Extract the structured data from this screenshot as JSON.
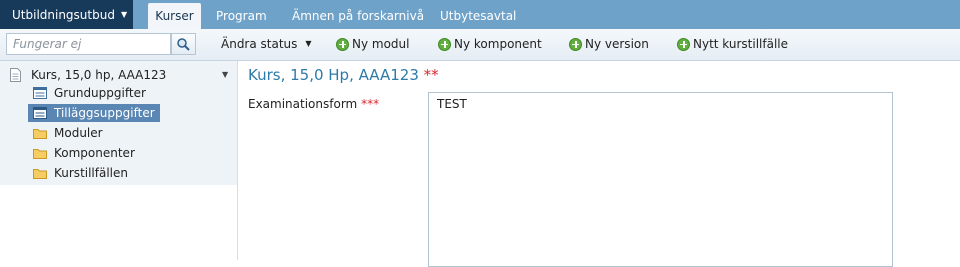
{
  "topbar": {
    "app_menu": "Utbildningsutbud",
    "tabs": [
      {
        "label": "Kurser",
        "active": true
      },
      {
        "label": "Program",
        "active": false
      },
      {
        "label": "Ämnen på forskarnivå",
        "active": false
      },
      {
        "label": "Utbytesavtal",
        "active": false
      }
    ]
  },
  "toolbar": {
    "search_placeholder": "Fungerar ej",
    "status_label": "Ändra status",
    "actions": [
      "Ny modul",
      "Ny komponent",
      "Ny version",
      "Nytt kurstillfälle"
    ]
  },
  "sidebar": {
    "root": "Kurs, 15,0 hp, AAA123",
    "items": [
      {
        "label": "Grunduppgifter",
        "icon": "form-icon",
        "selected": false
      },
      {
        "label": "Tilläggsuppgifter",
        "icon": "form-icon",
        "selected": true
      },
      {
        "label": "Moduler",
        "icon": "folder-icon",
        "selected": false
      },
      {
        "label": "Komponenter",
        "icon": "folder-icon",
        "selected": false
      },
      {
        "label": "Kurstillfällen",
        "icon": "folder-icon",
        "selected": false
      }
    ]
  },
  "main": {
    "title": "Kurs, 15,0 Hp, AAA123",
    "title_marker": "**",
    "field_label": "Examinationsform",
    "field_marker": "***",
    "field_value": "TEST"
  },
  "colors": {
    "topbar": "#6fa2c9",
    "app_menu_bg": "#173a5b",
    "heading": "#2e7aa9",
    "required": "#d9282f",
    "selected": "#5a86b3"
  }
}
